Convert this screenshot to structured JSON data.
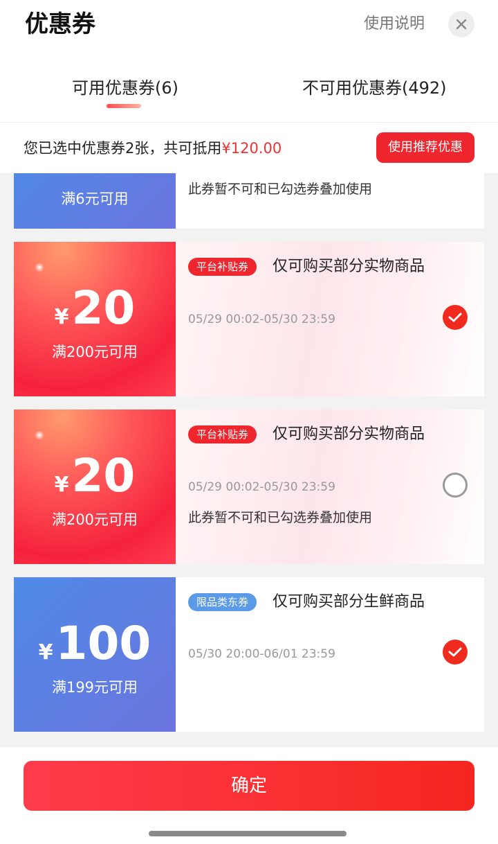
{
  "header": {
    "title": "优惠券",
    "help_label": "使用说明",
    "close_icon": "close-icon"
  },
  "tabs": {
    "available": "可用优惠券(6)",
    "unavailable": "不可用优惠券(492)",
    "active": "available"
  },
  "summary": {
    "text": "您已选中优惠券2张，共可抵用",
    "amount": "¥120.00",
    "recommend_label": "使用推荐优惠"
  },
  "coupons": [
    {
      "condition": "满6元可用",
      "note": "此券暂不可和已勾选券叠加使用",
      "color": "blue"
    },
    {
      "currency": "¥",
      "amount": "20",
      "condition": "满200元可用",
      "badge": "平台补贴券",
      "title": "仅可购买部分实物商品",
      "date": "05/29 00:02-05/30 23:59",
      "selected": true,
      "color": "red"
    },
    {
      "currency": "¥",
      "amount": "20",
      "condition": "满200元可用",
      "badge": "平台补贴券",
      "title": "仅可购买部分实物商品",
      "date": "05/29 00:02-05/30 23:59",
      "note": "此券暂不可和已勾选券叠加使用",
      "selected": false,
      "color": "red"
    },
    {
      "currency": "¥",
      "amount": "100",
      "condition": "满199元可用",
      "badge": "限品类东券",
      "title": "仅可购买部分生鲜商品",
      "date": "05/30 20:00-06/01 23:59",
      "selected": true,
      "color": "blue"
    }
  ],
  "footer": {
    "confirm_label": "确定"
  },
  "colors": {
    "accent_red": "#f0262e",
    "blue_coupon": "#5b7fe3",
    "check_red": "#f02a1e"
  }
}
